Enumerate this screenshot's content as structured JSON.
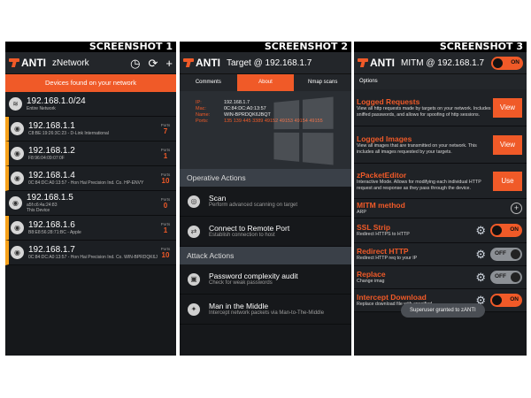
{
  "captions": [
    "SCREENSHOT 1",
    "SCREENSHOT 2",
    "SCREENSHOT 3"
  ],
  "app_name": "ANTI",
  "screen1": {
    "title": "zNetwork",
    "icons": [
      "history-icon",
      "refresh-icon",
      "add-icon"
    ],
    "banner": "Devices found on your network",
    "ports_label": "Ports",
    "hosts": [
      {
        "ip": "192.168.1.0/24",
        "sub": "Entire Network",
        "ports": "",
        "marked": false
      },
      {
        "ip": "192.168.1.1",
        "sub": "C8:BE:19:26:3C:23 - D-Link International",
        "ports": "7",
        "marked": true
      },
      {
        "ip": "192.168.1.2",
        "sub": "F8:96:04:09:07:0F",
        "ports": "1",
        "marked": true
      },
      {
        "ip": "192.168.1.4",
        "sub": "0C:84:DC:A0:13:57 - Hon Hai Precision Ind. Co. HP-ENVY",
        "ports": "10",
        "marked": true
      },
      {
        "ip": "192.168.1.5",
        "sub": "a5f:c6:4a:24:83\nThis Device",
        "ports": "0",
        "marked": false
      },
      {
        "ip": "192.168.1.6",
        "sub": "B8:E8:56:28:71:BC - Apple",
        "ports": "1",
        "marked": true
      },
      {
        "ip": "192.168.1.7",
        "sub": "0C:84:DC:A0:13:57 - Hon Hai Precision Ind. Co. WIN-BPRDQK6JBQT",
        "ports": "10",
        "marked": true
      }
    ]
  },
  "screen2": {
    "title": "Target @ 192.168.1.7",
    "tabs": [
      "Comments",
      "About",
      "Nmap scans"
    ],
    "active_tab": 1,
    "info": [
      {
        "k": "IP:",
        "v": "192.168.1.7",
        "red": false
      },
      {
        "k": "Mac:",
        "v": "0C:84:DC:A0:13:57",
        "red": false
      },
      {
        "k": "Name:",
        "v": "WIN-BPRDQK6JBQT",
        "red": false
      },
      {
        "k": "Ports:",
        "v": "135 139 445 3389 49152 49153 49154 49155",
        "red": true
      }
    ],
    "sections": [
      {
        "title": "Operative Actions",
        "actions": [
          {
            "title": "Scan",
            "sub": "Perform advanced scanning on target",
            "icon": "scan-icon"
          },
          {
            "title": "Connect to Remote Port",
            "sub": "Establish connection to host",
            "icon": "connect-icon"
          }
        ]
      },
      {
        "title": "Attack Actions",
        "actions": [
          {
            "title": "Password complexity audit",
            "sub": "Check for weak passwords",
            "icon": "lock-icon"
          },
          {
            "title": "Man in the Middle",
            "sub": "Intercept network packets via Man-to-The-Middle",
            "icon": "mitm-icon"
          }
        ]
      }
    ]
  },
  "screen3": {
    "title": "MITM @ 192.168.1.7",
    "toggle_on": "ON",
    "toggle_off": "OFF",
    "options_label": "Options",
    "items": [
      {
        "title": "Logged Requests",
        "desc": "View all http requests made by targets on your network. Includes sniffed passwords, and allows for spoofing of http sessions.",
        "control": "button",
        "label": "View"
      },
      {
        "title": "Logged Images",
        "desc": "View all images that are transmitted on your network. This includes all images requested by your targets.",
        "control": "button",
        "label": "View"
      },
      {
        "title": "zPacketEditor",
        "desc": "Interactive Mode. Allows for modifying each individual HTTP request and response as they pass through the device.",
        "control": "button",
        "label": "Use"
      },
      {
        "title": "MITM method",
        "desc": "ARP",
        "control": "plus",
        "label": ""
      },
      {
        "title": "SSL Strip",
        "desc": "Redirect HTTPS to HTTP",
        "control": "toggle",
        "state": "on"
      },
      {
        "title": "Redirect HTTP",
        "desc": "Redirect HTTP req to your IP",
        "control": "toggle",
        "state": "off"
      },
      {
        "title": "Replace",
        "desc": "Change imag",
        "control": "toggle",
        "state": "off"
      },
      {
        "title": "Intercept Download",
        "desc": "Replace download file with specified",
        "control": "toggle",
        "state": "on"
      }
    ],
    "toast": "Superuser granted to zANTI"
  }
}
